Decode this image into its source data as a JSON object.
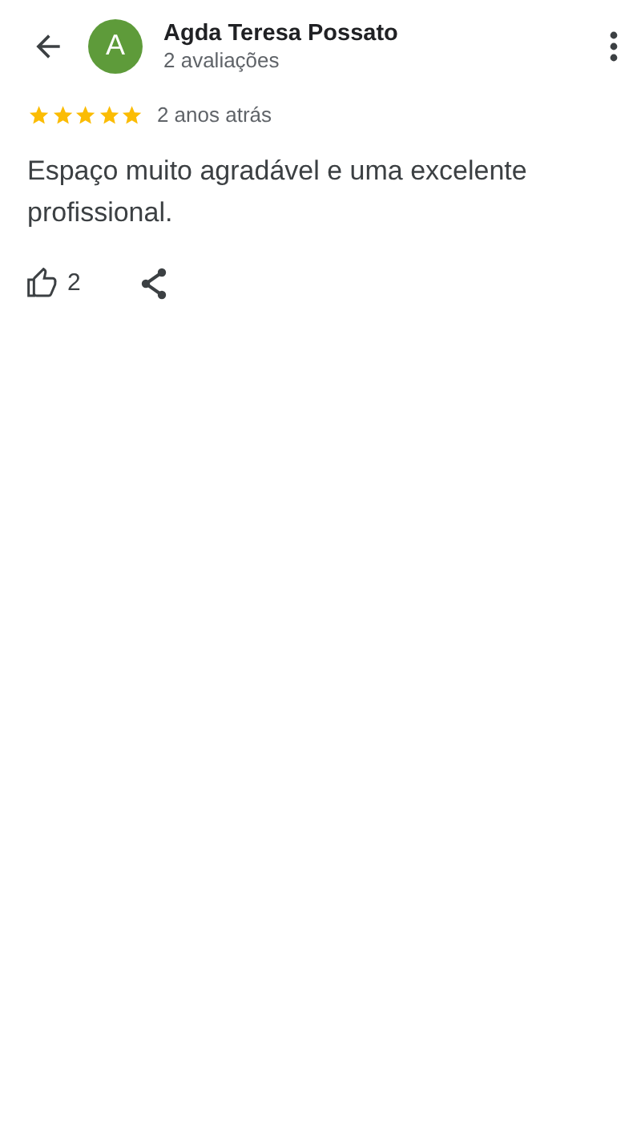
{
  "header": {
    "avatar_letter": "A",
    "name": "Agda Teresa Possato",
    "subtitle": "2 avaliações"
  },
  "review": {
    "stars": 5,
    "time": "2 anos atrás",
    "text": "Espaço muito agradável e uma excelente profissional."
  },
  "actions": {
    "likes": "2"
  }
}
